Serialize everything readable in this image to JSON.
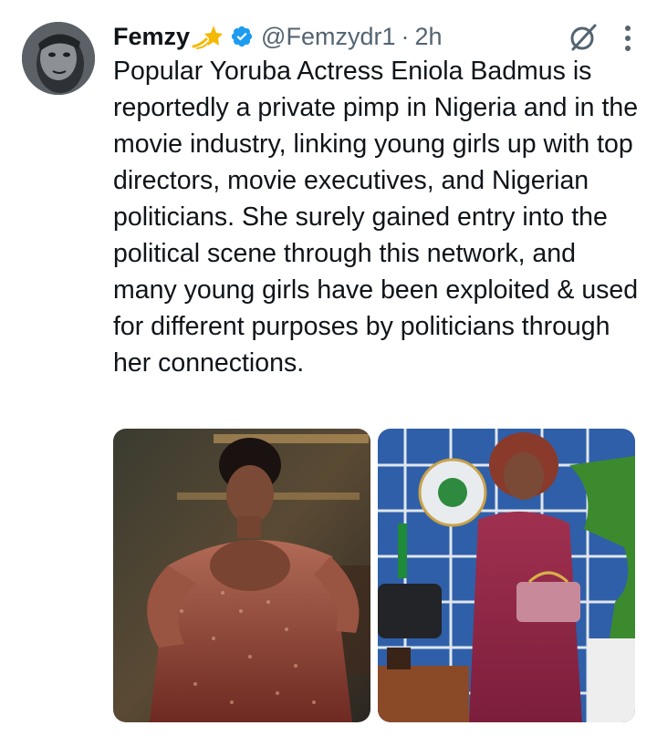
{
  "tweet": {
    "author_name": "Femzy",
    "name_emoji": "dizzy-star-icon",
    "verified_icon": "verified-badge-icon",
    "handle": "@Femzydr1",
    "separator": "·",
    "time_ago": "2h",
    "text": "Popular Yoruba Actress Eniola Badmus is reportedly a private pimp in Nigeria and in the movie industry, linking young girls up with top directors, movie executives, and Nigerian politicians. She surely gained entry into the political scene through this network, and many young girls have been exploited & used for different purposes by politicians through her connections.",
    "media_count": 2
  },
  "icons": {
    "grok": "grok-icon",
    "more": "more-vertical-icon"
  },
  "colors": {
    "text": "#0f1419",
    "secondary": "#536471",
    "verified": "#1d9bf0",
    "gold_emoji": "#f5b800"
  }
}
